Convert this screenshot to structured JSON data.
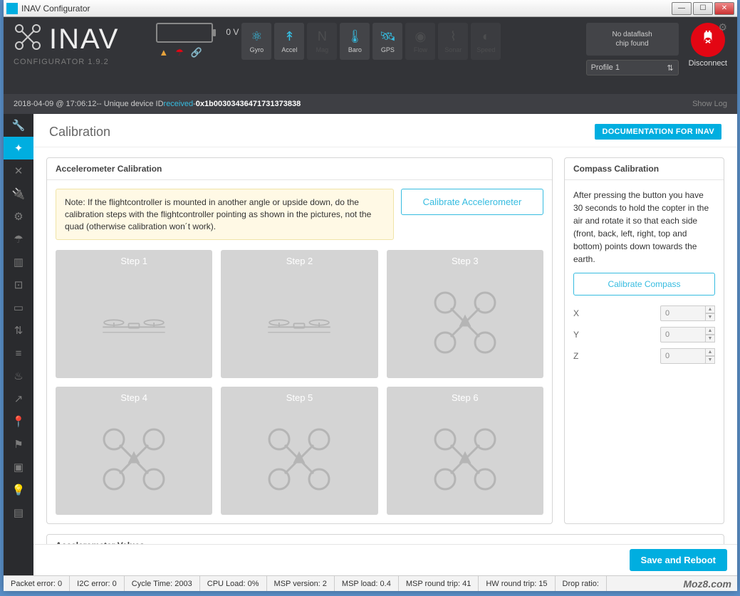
{
  "window": {
    "title": "INAV Configurator"
  },
  "brand": {
    "name": "INAV",
    "subtitle": "CONFIGURATOR  1.9.2"
  },
  "battery": {
    "voltage": "0 V"
  },
  "sensors": [
    {
      "label": "Gyro",
      "active": true
    },
    {
      "label": "Accel",
      "active": true
    },
    {
      "label": "Mag",
      "active": false
    },
    {
      "label": "Baro",
      "active": true
    },
    {
      "label": "GPS",
      "active": true
    },
    {
      "label": "Flow",
      "active": false
    },
    {
      "label": "Sonar",
      "active": false
    },
    {
      "label": "Speed",
      "active": false
    }
  ],
  "dataflash": {
    "text": "No dataflash\nchip found"
  },
  "profile": {
    "selected": "Profile 1"
  },
  "disconnect_label": "Disconnect",
  "log": {
    "timestamp": "2018-04-09 @ 17:06:12",
    "msg_prefix": " -- Unique device ID ",
    "link_word": "received",
    "msg_suffix": " - ",
    "device_id": "0x1b00303436471731373838",
    "showlog": "Show Log"
  },
  "page": {
    "title": "Calibration",
    "doc_button": "DOCUMENTATION FOR INAV"
  },
  "accel_panel": {
    "title": "Accelerometer Calibration",
    "note": "Note: If the flightcontroller is mounted in another angle or upside down, do the calibration steps with the flightcontroller pointing as shown in the pictures, not the quad (otherwise calibration won´t work).",
    "calibrate_btn": "Calibrate Accelerometer",
    "steps": [
      "Step 1",
      "Step 2",
      "Step 3",
      "Step 4",
      "Step 5",
      "Step 6"
    ]
  },
  "compass_panel": {
    "title": "Compass Calibration",
    "desc": "After pressing the button you have 30 seconds to hold the copter in the air and rotate it so that each side (front, back, left, right, top and bottom) points down towards the earth.",
    "btn": "Calibrate Compass",
    "axes": [
      {
        "label": "X",
        "value": "0"
      },
      {
        "label": "Y",
        "value": "0"
      },
      {
        "label": "Z",
        "value": "0"
      }
    ]
  },
  "accel_values_title": "Accelerometer Values",
  "save_btn": "Save and Reboot",
  "status": {
    "packet_error": "Packet error: 0",
    "i2c_error": "I2C error: 0",
    "cycle_time": "Cycle Time: 2003",
    "cpu_load": "CPU Load: 0%",
    "msp_version": "MSP version: 2",
    "msp_load": "MSP load: 0.4",
    "msp_round_trip": "MSP round trip: 41",
    "hw_round_trip": "HW round trip: 15",
    "drop_ratio": "Drop ratio:"
  },
  "watermark": "Moz8.com"
}
